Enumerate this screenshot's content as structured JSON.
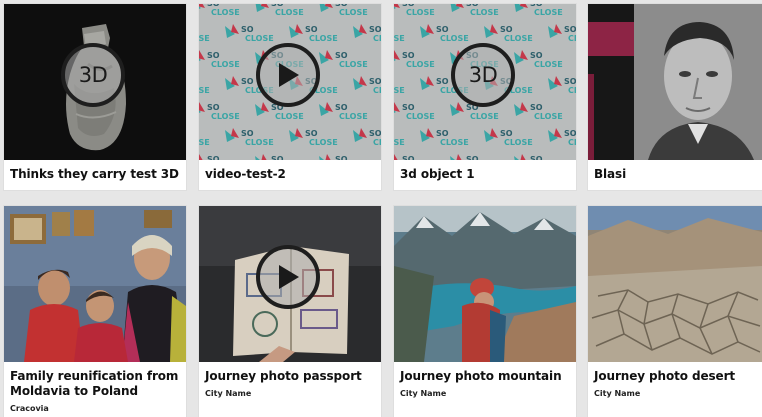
{
  "watermark_text": "SO CLOSE",
  "cards": [
    {
      "title": "Thinks they carry test 3D",
      "subtitle": "",
      "media": "3d-object",
      "badge": "3D"
    },
    {
      "title": "video-test-2",
      "subtitle": "",
      "media": "video",
      "badge": ""
    },
    {
      "title": "3d object 1",
      "subtitle": "",
      "media": "3d-object",
      "badge": "3D"
    },
    {
      "title": "Blasi",
      "subtitle": "",
      "media": "image",
      "badge": ""
    },
    {
      "title": "Family reunification from Moldavia to Poland",
      "subtitle": "Cracovia",
      "media": "image",
      "badge": ""
    },
    {
      "title": "Journey photo passport",
      "subtitle": "City Name",
      "media": "video",
      "badge": ""
    },
    {
      "title": "Journey photo mountain",
      "subtitle": "City Name",
      "media": "image",
      "badge": ""
    },
    {
      "title": "Journey photo desert",
      "subtitle": "City Name",
      "media": "image",
      "badge": ""
    }
  ],
  "colors": {
    "page_bg": "#e6e6e6",
    "card_bg": "#ffffff",
    "logo_teal": "#3aa5a5",
    "logo_red": "#c4384a"
  }
}
